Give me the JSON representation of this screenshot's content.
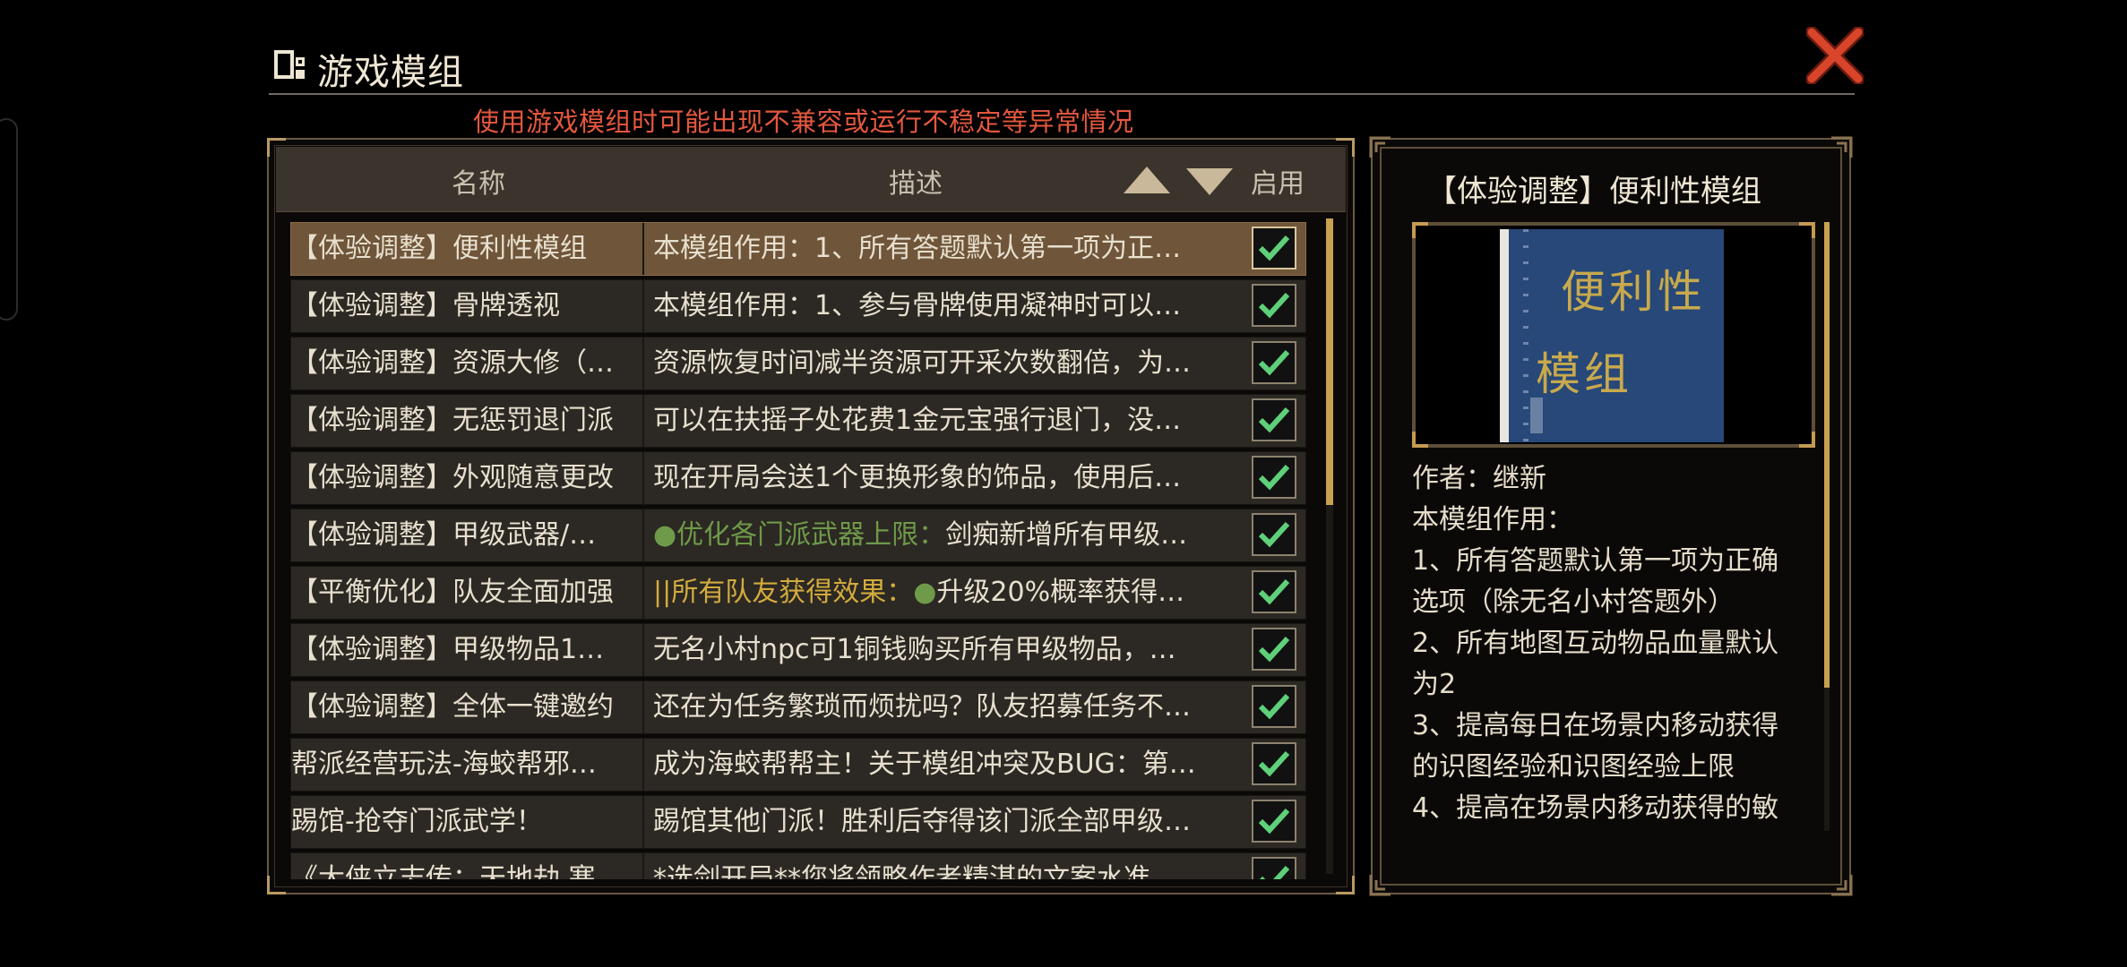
{
  "header": {
    "title": "游戏模组",
    "warning": "使用游戏模组时可能出现不兼容或运行不稳定等异常情况"
  },
  "columns": {
    "name": "名称",
    "description": "描述",
    "enable": "启用"
  },
  "mods": [
    {
      "name": "【体验调整】便利性模组",
      "desc": "本模组作用：1、所有答题默认第一项为正…",
      "enabled": true,
      "selected": true
    },
    {
      "name": "【体验调整】骨牌透视",
      "desc": "本模组作用：1、参与骨牌使用凝神时可以…",
      "enabled": true
    },
    {
      "name": "【体验调整】资源大修（…",
      "desc": "资源恢复时间减半资源可开采次数翻倍，为…",
      "enabled": true
    },
    {
      "name": "【体验调整】无惩罚退门派",
      "desc": "可以在扶摇子处花费1金元宝强行退门，没…",
      "enabled": true
    },
    {
      "name": "【体验调整】外观随意更改",
      "desc": "现在开局会送1个更换形象的饰品，使用后…",
      "enabled": true
    },
    {
      "name": "【体验调整】甲级武器/…",
      "desc_green": "●优化各门派武器上限：",
      "desc": "剑痴新增所有甲级…",
      "enabled": true
    },
    {
      "name": "【平衡优化】队友全面加强",
      "desc_gold": "||所有队友获得效果：",
      "desc_dot": "●",
      "desc": "升级20%概率获得…",
      "enabled": true
    },
    {
      "name": "【体验调整】甲级物品1…",
      "desc": "无名小村npc可1铜钱购买所有甲级物品，…",
      "enabled": true
    },
    {
      "name": "【体验调整】全体一键邀约",
      "desc": "还在为任务繁琐而烦扰吗？队友招募任务不…",
      "enabled": true
    },
    {
      "name": "帮派经营玩法-海蛟帮邪…",
      "desc": "成为海蛟帮帮主！关于模组冲突及BUG：第…",
      "enabled": true
    },
    {
      "name": "踢馆-抢夺门派武学！",
      "desc": "踢馆其他门派！胜利后夺得该门派全部甲级…",
      "enabled": true
    },
    {
      "name": "《大侠立志传：天地劫 寒…",
      "desc": "*选剑开局**您将领略作者精湛的文案水准…",
      "enabled": true
    }
  ],
  "detail": {
    "title": "【体验调整】便利性模组",
    "preview_text": [
      "便利性",
      "模组"
    ],
    "lines": [
      "作者：继新",
      "本模组作用：",
      "1、所有答题默认第一项为正确",
      "选项（除无名小村答题外）",
      "2、所有地图互动物品血量默认",
      "为2",
      "3、提高每日在场景内移动获得",
      "的识图经验和识图经验上限",
      "4、提高在场景内移动获得的敏"
    ]
  },
  "colors": {
    "accent_gold": "#c8a150",
    "warning_red": "#e4583f",
    "check_green": "#5ed07a",
    "selected_row": "#6f5539"
  },
  "icons": {
    "close": "close-x-icon",
    "sort_up": "triangle-up-icon",
    "sort_down": "triangle-down-icon",
    "check": "check-icon",
    "title": "mod-icon"
  }
}
